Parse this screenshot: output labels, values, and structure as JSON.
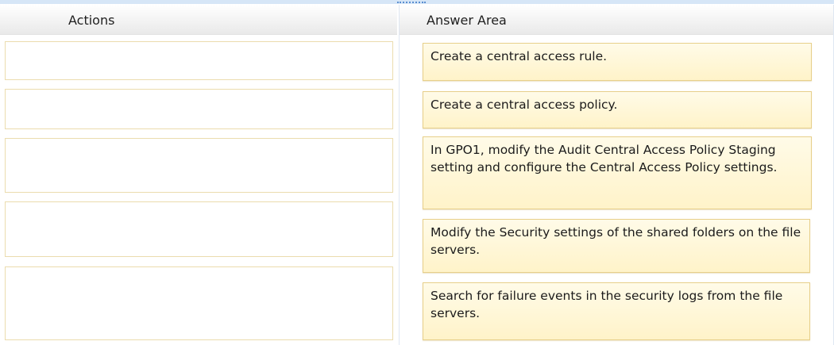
{
  "actions": {
    "header": "Actions",
    "slots": [
      "",
      "",
      "",
      "",
      ""
    ]
  },
  "answer_area": {
    "header": "Answer Area",
    "items": [
      "Create a central access rule.",
      "Create a central access policy.",
      "In GPO1, modify the Audit Central Access Policy Staging setting and configure the Central Access Policy settings.",
      "Modify the Security settings of the shared folders on the file servers.",
      "Search for failure events in the security logs from the file servers."
    ]
  }
}
